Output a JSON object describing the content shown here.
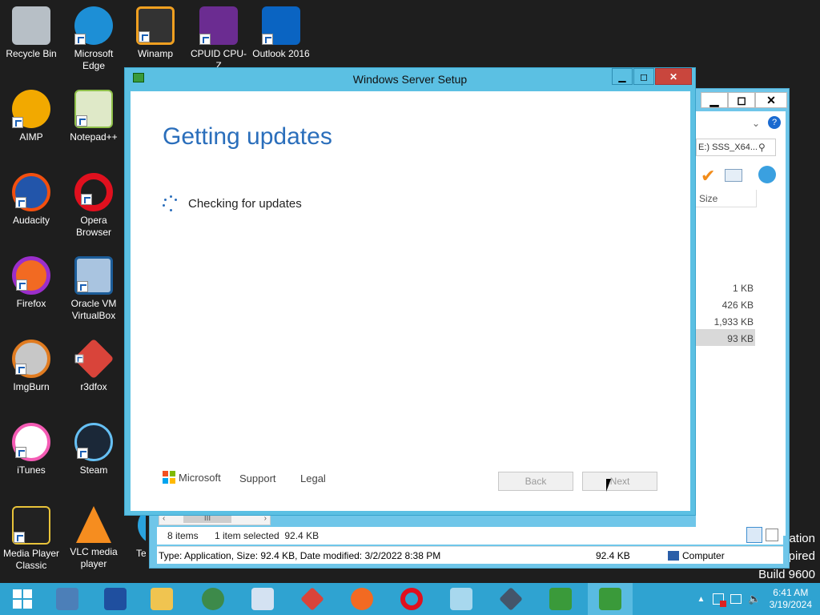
{
  "desktop_icons": [
    {
      "label": "Recycle Bin",
      "icon": "recycle-bin-icon",
      "color": "#c0c7cc"
    },
    {
      "label": "Microsoft Edge",
      "icon": "edge-icon",
      "color": "#1d8fd6"
    },
    {
      "label": "Winamp",
      "icon": "winamp-icon",
      "color": "#f0a020"
    },
    {
      "label": "CPUID CPU-Z",
      "icon": "cpuz-icon",
      "color": "#6b2c91"
    },
    {
      "label": "Outlook 2016",
      "icon": "outlook-icon",
      "color": "#0a64c2"
    },
    {
      "label": "AIMP",
      "icon": "aimp-icon",
      "color": "#f2a900"
    },
    {
      "label": "Notepad++",
      "icon": "notepadpp-icon",
      "color": "#8fc04a"
    },
    {
      "label": "Audacity",
      "icon": "audacity-icon",
      "color": "#f24f0f"
    },
    {
      "label": "Opera Browser",
      "icon": "opera-icon",
      "color": "#e0101e"
    },
    {
      "label": "Firefox",
      "icon": "firefox-icon",
      "color": "#f26a22"
    },
    {
      "label": "Oracle VM VirtualBox",
      "icon": "virtualbox-icon",
      "color": "#1c5d99"
    },
    {
      "label": "ImgBurn",
      "icon": "imgburn-icon",
      "color": "#c7c7c7"
    },
    {
      "label": "r3dfox",
      "icon": "r3dfox-icon",
      "color": "#d9443a"
    },
    {
      "label": "iTunes",
      "icon": "itunes-icon",
      "color": "#f45bb4"
    },
    {
      "label": "Steam",
      "icon": "steam-icon",
      "color": "#1b2838"
    },
    {
      "label": "Media Player Classic",
      "icon": "mpc-icon",
      "color": "#222222"
    },
    {
      "label": "VLC media player",
      "icon": "vlc-icon",
      "color": "#f68d1f"
    },
    {
      "label": "Tel",
      "icon": "telegram-icon",
      "color": "#2aa3de"
    }
  ],
  "setup": {
    "title": "Windows Server Setup",
    "heading": "Getting updates",
    "status": "Checking for updates",
    "brand": "Microsoft",
    "support": "Support",
    "legal": "Legal",
    "back": "Back",
    "next": "Next"
  },
  "explorer": {
    "search_text": "E:) SSS_X64...",
    "size_header": "Size",
    "sizes": [
      "1 KB",
      "426 KB",
      "1,933 KB",
      "93 KB"
    ],
    "items_count": "8 items",
    "selected": "1 item selected  92.4 KB",
    "status_detail": "Type: Application, Size: 92.4 KB, Date modified: 3/2/2022 8:38 PM",
    "status_size": "92.4 KB",
    "status_location": "Computer"
  },
  "watermark": {
    "line1": "ation",
    "line2": "pired",
    "line3": "Build 9600"
  },
  "taskbar": {
    "items": [
      "start-icon",
      "server-manager-icon",
      "powershell-icon",
      "file-explorer-icon",
      "network-icon",
      "remote-desktop-icon",
      "r3dfox-icon",
      "firefox-icon",
      "opera-icon",
      "notepad-icon",
      "visual-studio-icon",
      "setup-icon",
      "setup-active-icon"
    ],
    "time": "6:41 AM",
    "date": "3/19/2024"
  },
  "colors": {
    "accent": "#2a6ebb",
    "window_frame": "#5bc0e3",
    "taskbar": "#2fa3d1"
  }
}
